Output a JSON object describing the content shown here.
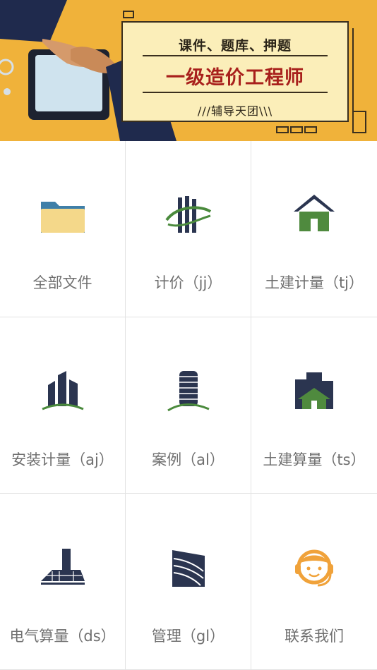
{
  "banner": {
    "subtitle": "课件、题库、押题",
    "title": "一级造价工程师",
    "tagline": "///辅导天团\\\\\\"
  },
  "grid": [
    {
      "label": "全部文件",
      "icon": "folder-icon"
    },
    {
      "label": "计价（jj）",
      "icon": "building-swirl-icon"
    },
    {
      "label": "土建计量（tj）",
      "icon": "house-icon"
    },
    {
      "label": "安装计量（aj）",
      "icon": "skyscraper-icon"
    },
    {
      "label": "案例（al）",
      "icon": "round-tower-icon"
    },
    {
      "label": "土建算量（ts）",
      "icon": "city-house-icon"
    },
    {
      "label": "电气算量（ds）",
      "icon": "factory-building-icon"
    },
    {
      "label": "管理（gl）",
      "icon": "stacked-building-icon"
    },
    {
      "label": "联系我们",
      "icon": "headset-support-icon"
    }
  ]
}
